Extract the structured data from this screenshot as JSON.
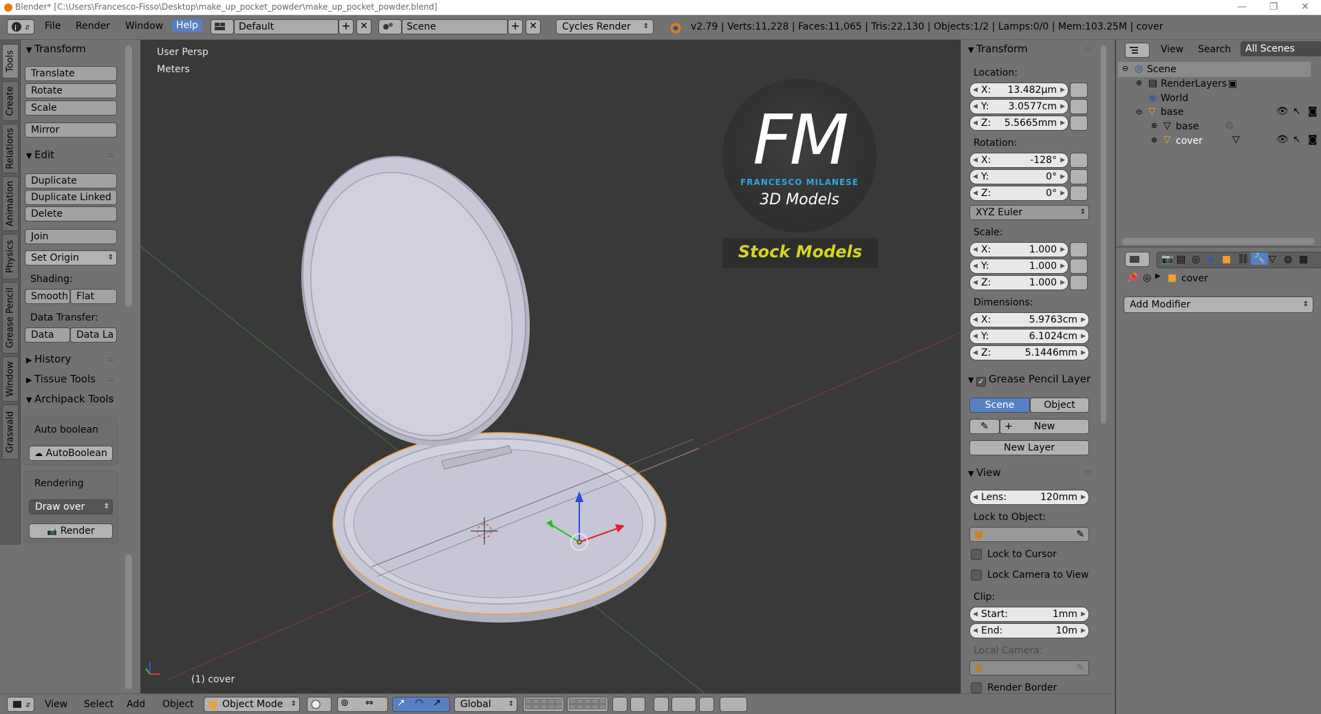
{
  "window": {
    "title": "Blender* [C:\\Users\\Francesco-Fisso\\Desktop\\make_up_pocket_powder\\make_up_pocket_powder.blend]",
    "controls": [
      "—",
      "❐",
      "✕"
    ]
  },
  "info_header": {
    "menus": [
      "File",
      "Render",
      "Window",
      "Help"
    ],
    "active_menu": "Help",
    "screen_layout": "Default",
    "scene": "Scene",
    "render_engine": "Cycles Render",
    "stats": "v2.79 | Verts:11,228 | Faces:11,065 | Tris:22,130 | Objects:1/2 | Lamps:0/0 | Mem:103.25M | cover"
  },
  "vertical_tabs": [
    "Tools",
    "Create",
    "Relations",
    "Animation",
    "Physics",
    "Grease Pencil",
    "Window",
    "Graswald"
  ],
  "tool_shelf": {
    "transform": {
      "title": "Transform",
      "buttons": [
        "Translate",
        "Rotate",
        "Scale",
        "Mirror"
      ]
    },
    "edit": {
      "title": "Edit",
      "buttons": [
        "Duplicate",
        "Duplicate Linked",
        "Delete",
        "Join"
      ],
      "set_origin": "Set Origin"
    },
    "shading": {
      "label": "Shading:",
      "smooth": "Smooth",
      "flat": "Flat"
    },
    "data_transfer": {
      "label": "Data Transfer:",
      "data": "Data",
      "data_la": "Data La"
    },
    "collapsed": [
      "History",
      "Tissue Tools"
    ],
    "archipack": {
      "title": "Archipack Tools"
    },
    "auto_boolean": {
      "label": "Auto boolean",
      "button": "AutoBoolean"
    },
    "rendering": {
      "label": "Rendering",
      "mode": "Draw over",
      "button": "Render"
    }
  },
  "viewport": {
    "view_name": "User Persp",
    "units": "Meters",
    "selected": "(1) cover",
    "watermark": {
      "initials": "FM",
      "name": "FRANCESCO MILANESE",
      "tagline": "3D Models",
      "banner": "Stock Models"
    }
  },
  "n_panel": {
    "transform_title": "Transform",
    "location": {
      "label": "Location:",
      "x": "13.482µm",
      "y": "3.0577cm",
      "z": "5.5665mm"
    },
    "rotation": {
      "label": "Rotation:",
      "x": "-128°",
      "y": "0°",
      "z": "0°",
      "mode": "XYZ Euler"
    },
    "scale": {
      "label": "Scale:",
      "x": "1.000",
      "y": "1.000",
      "z": "1.000"
    },
    "dimensions": {
      "label": "Dimensions:",
      "x": "5.9763cm",
      "y": "6.1024cm",
      "z": "5.1446mm"
    },
    "axis": {
      "x": "X:",
      "y": "Y:",
      "z": "Z:"
    },
    "grease_pencil": {
      "title": "Grease Pencil Layer",
      "scene": "Scene",
      "object": "Object",
      "new": "New",
      "new_layer": "New Layer"
    },
    "view": {
      "title": "View",
      "lens_label": "Lens:",
      "lens": "120mm",
      "lock_to_object": "Lock to Object:",
      "lock_to_cursor": "Lock to Cursor",
      "lock_camera": "Lock Camera to View",
      "clip": "Clip:",
      "start_label": "Start:",
      "start": "1mm",
      "end_label": "End:",
      "end": "10m",
      "local_camera": "Local Camera:",
      "render_border": "Render Border"
    }
  },
  "outliner": {
    "header": {
      "view": "View",
      "search": "Search",
      "filter": "All Scenes"
    },
    "rows": [
      "Scene",
      "RenderLayers",
      "World",
      "base",
      "base",
      "cover"
    ]
  },
  "properties": {
    "object": "cover",
    "add_modifier": "Add Modifier"
  },
  "bottom_bar": {
    "menus": [
      "View",
      "Select",
      "Add",
      "Object"
    ],
    "mode": "Object Mode",
    "orientation": "Global"
  },
  "colors": {
    "panel_bg": "#727272",
    "viewport_bg": "#393939",
    "accent_blue": "#5680c2",
    "object_orange": "#f0a030",
    "watermark_blue": "#29a8e0",
    "watermark_yellow": "#d4d428"
  }
}
